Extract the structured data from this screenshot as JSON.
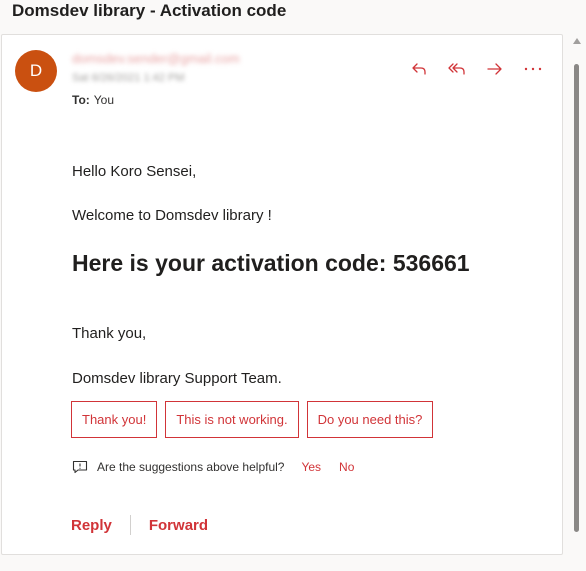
{
  "subject": "Domsdev library - Activation code",
  "message": {
    "avatar_initial": "D",
    "sender": "domsdev.sender@gmail.com",
    "date": "Sat 6/26/2021 1:42 PM",
    "to_label": "To:",
    "to_value": "You",
    "actions": [
      "reply-icon",
      "reply-all-icon",
      "forward-icon",
      "more-icon"
    ],
    "more_label": "···"
  },
  "body": {
    "greeting": "Hello Koro Sensei,",
    "welcome": "Welcome to Domsdev library !",
    "headline": "Here is your activation code: 536661",
    "thanks": "Thank you,",
    "signature": "Domsdev library Support Team."
  },
  "suggestions": {
    "buttons": [
      "Thank you!",
      "This is not working.",
      "Do you need this?"
    ],
    "question": "Are the suggestions above helpful?",
    "yes": "Yes",
    "no": "No"
  },
  "footer": {
    "reply": "Reply",
    "forward": "Forward"
  },
  "colors": {
    "accent": "#d13438",
    "avatar": "#ca5010"
  }
}
